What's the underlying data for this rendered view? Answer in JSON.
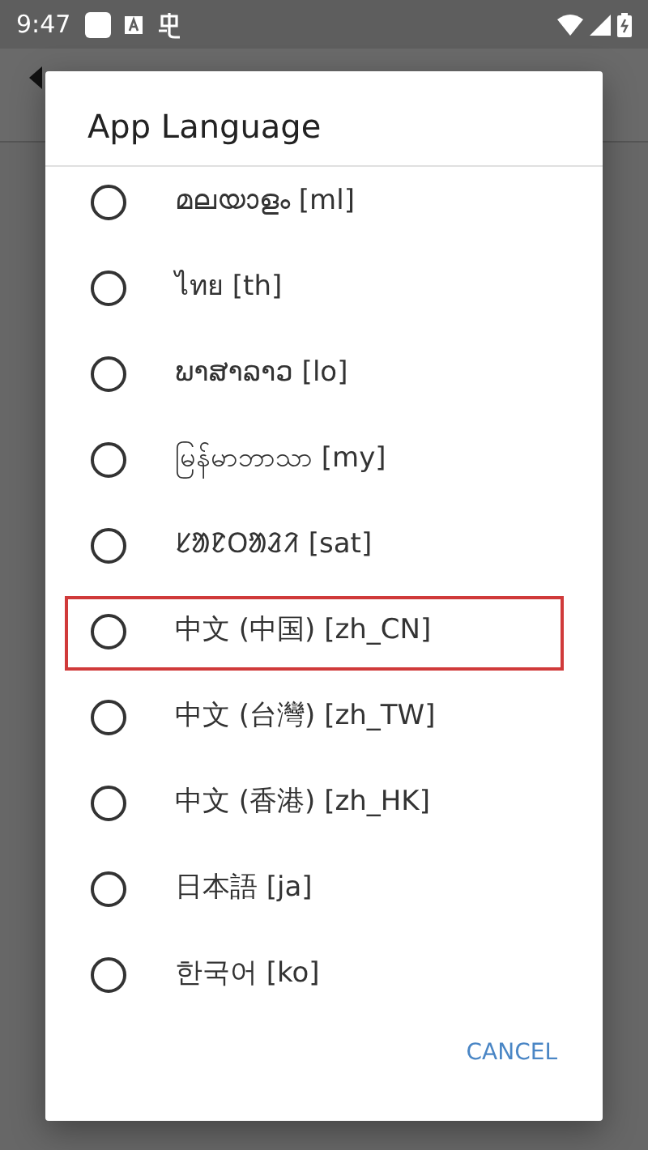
{
  "status_bar": {
    "time": "9:47"
  },
  "dialog": {
    "title": "App Language",
    "options": [
      {
        "label": "മലയാളം [ml]",
        "selected": false,
        "highlighted": false
      },
      {
        "label": "ไทย [th]",
        "selected": false,
        "highlighted": false
      },
      {
        "label": "ພາສາລາວ [lo]",
        "selected": false,
        "highlighted": false
      },
      {
        "label": "မြန်မာဘာသာ [my]",
        "selected": false,
        "highlighted": false
      },
      {
        "label": "ᱥᱟᱱᱛᱟᱲᱤ [sat]",
        "selected": false,
        "highlighted": false
      },
      {
        "label": "中文 (中国) [zh_CN]",
        "selected": false,
        "highlighted": true
      },
      {
        "label": "中文 (台灣) [zh_TW]",
        "selected": false,
        "highlighted": false
      },
      {
        "label": "中文 (香港) [zh_HK]",
        "selected": false,
        "highlighted": false
      },
      {
        "label": "日本語 [ja]",
        "selected": false,
        "highlighted": false
      },
      {
        "label": "한국어 [ko]",
        "selected": false,
        "highlighted": false
      }
    ],
    "buttons": [
      "CANCEL"
    ]
  }
}
